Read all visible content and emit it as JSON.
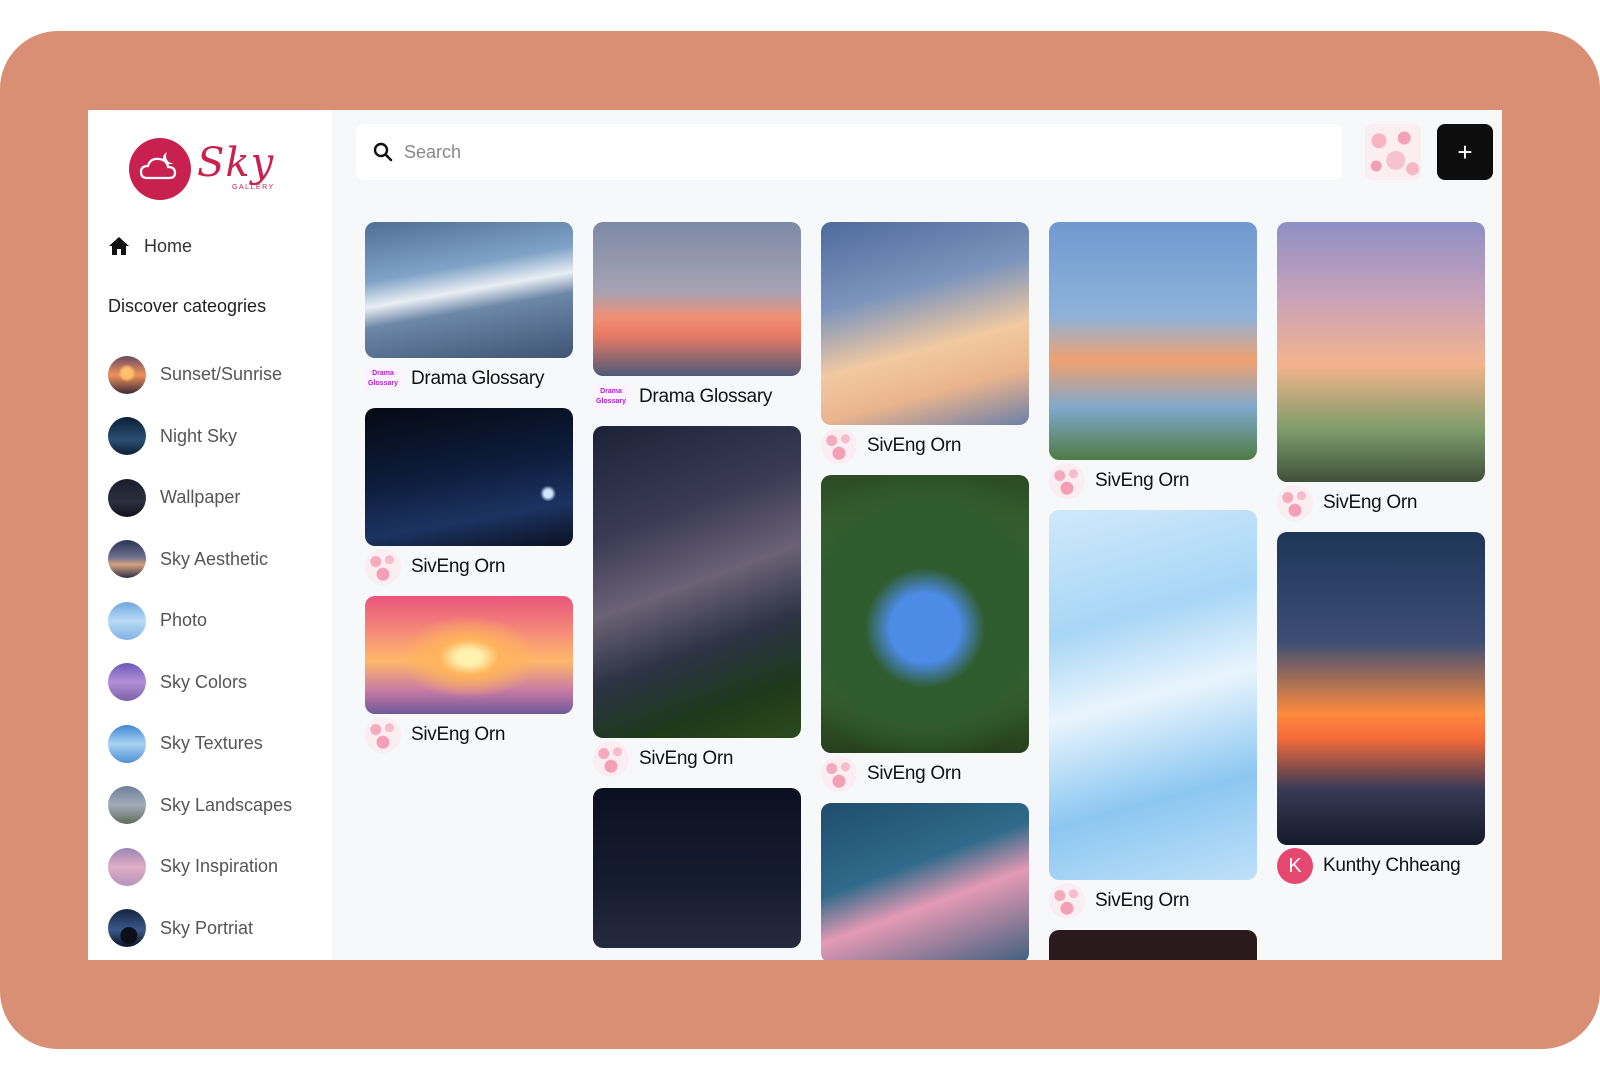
{
  "brand": {
    "name": "Sky",
    "subtitle": "GALLERY"
  },
  "nav": {
    "home_label": "Home"
  },
  "sidebar": {
    "section_title": "Discover cateogries",
    "categories": [
      {
        "label": "Sunset/Sunrise"
      },
      {
        "label": "Night Sky"
      },
      {
        "label": "Wallpaper"
      },
      {
        "label": "Sky Aesthetic"
      },
      {
        "label": "Photo"
      },
      {
        "label": "Sky Colors"
      },
      {
        "label": "Sky Textures"
      },
      {
        "label": "Sky Landscapes"
      },
      {
        "label": "Sky Inspiration"
      },
      {
        "label": "Sky Portriat"
      }
    ]
  },
  "search": {
    "placeholder": "Search",
    "value": ""
  },
  "toolbar": {
    "add_label": "+"
  },
  "feed": {
    "columns": [
      {
        "cards": [
          {
            "user": "Drama Glossary",
            "avatar_text": "Drama Glossary"
          },
          {
            "user": "SivEng Orn"
          },
          {
            "user": "SivEng Orn"
          }
        ]
      },
      {
        "cards": [
          {
            "user": "Drama Glossary",
            "avatar_text": "Drama Glossary"
          },
          {
            "user": "SivEng Orn"
          },
          {
            "user": ""
          }
        ]
      },
      {
        "cards": [
          {
            "user": "SivEng Orn"
          },
          {
            "user": "SivEng Orn"
          },
          {
            "user": ""
          }
        ]
      },
      {
        "cards": [
          {
            "user": "SivEng Orn"
          },
          {
            "user": "SivEng Orn"
          },
          {
            "user": ""
          }
        ]
      },
      {
        "cards": [
          {
            "user": "SivEng Orn"
          },
          {
            "user": "Kunthy Chheang",
            "avatar_letter": "K"
          }
        ]
      }
    ]
  },
  "colors": {
    "frame": "#d98f74",
    "brand": "#c8214f",
    "background": "#f7f8fa"
  }
}
